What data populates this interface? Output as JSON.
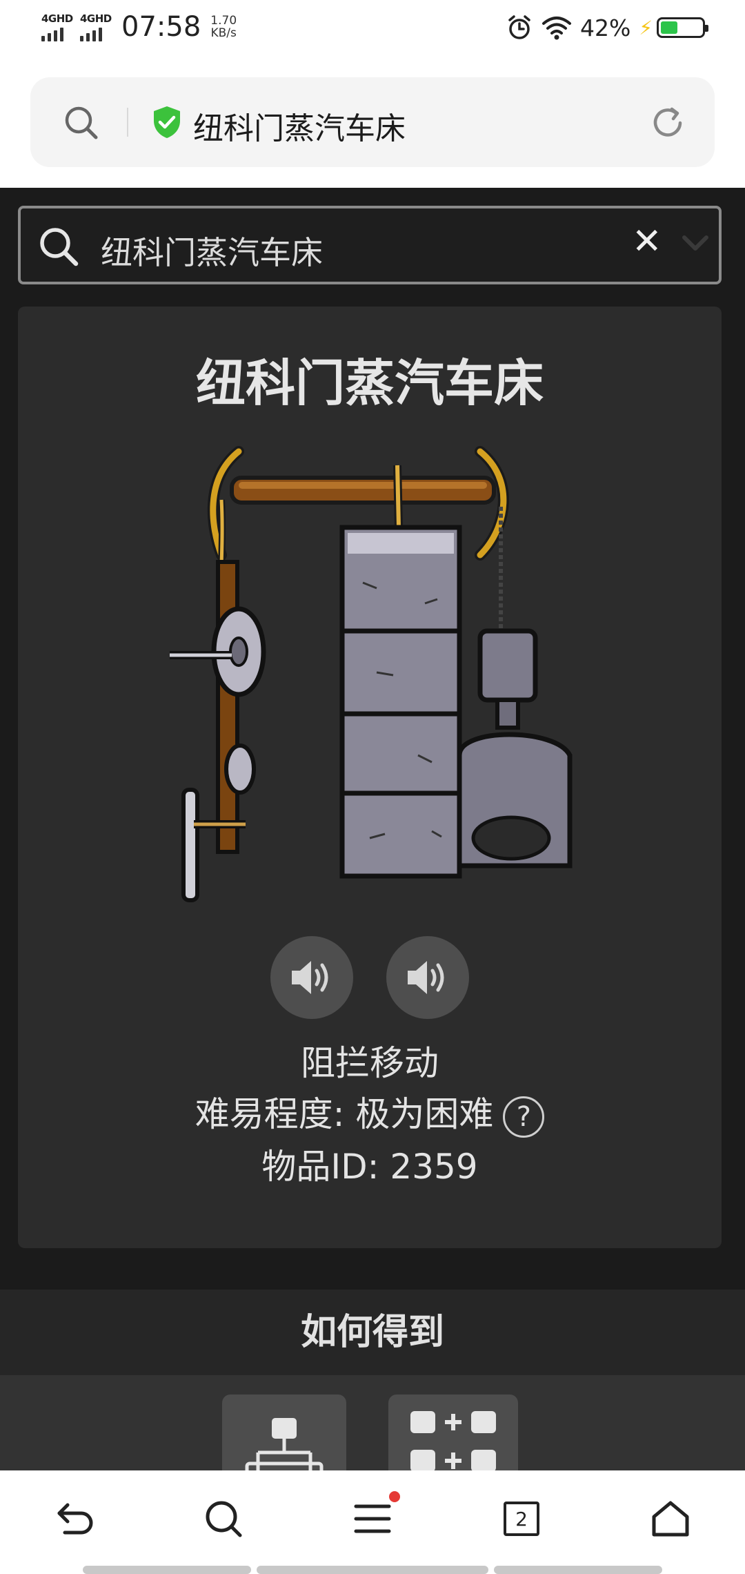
{
  "status_bar": {
    "sim1": "4GHD",
    "sim2": "4GHD",
    "time": "07:58",
    "speed_value": "1.70",
    "speed_unit": "KB/s",
    "battery_percent": "42%",
    "battery_level": 0.42,
    "icons": [
      "alarm-icon",
      "wifi-icon",
      "charging-icon",
      "battery-icon"
    ]
  },
  "browser": {
    "address_text": "纽科门蒸汽车床",
    "icons": [
      "search-icon",
      "secure-shield-icon",
      "reload-icon"
    ]
  },
  "page_search": {
    "value": "纽科门蒸汽车床",
    "clear_label": "✕"
  },
  "item": {
    "title": "纽科门蒸汽车床",
    "image_icon": "newcomen-steam-lathe-illustration",
    "sound_buttons": [
      "speaker-icon",
      "speaker-icon"
    ],
    "property": "阻拦移动",
    "difficulty": "难易程度: 极为困难",
    "help_label": "?",
    "item_id": "物品ID: 2359"
  },
  "how_to_get": {
    "heading": "如何得到"
  },
  "bottom_nav": {
    "tab_count": "2",
    "icons": [
      "back-icon",
      "search-icon",
      "menu-icon",
      "tabs-icon",
      "home-icon"
    ],
    "notification_color": "#e53935"
  },
  "colors": {
    "page_bg": "#1b1b1b",
    "card_bg": "#2c2c2c",
    "shield_green": "#3cc23c",
    "battery_green": "#2cc44a"
  }
}
